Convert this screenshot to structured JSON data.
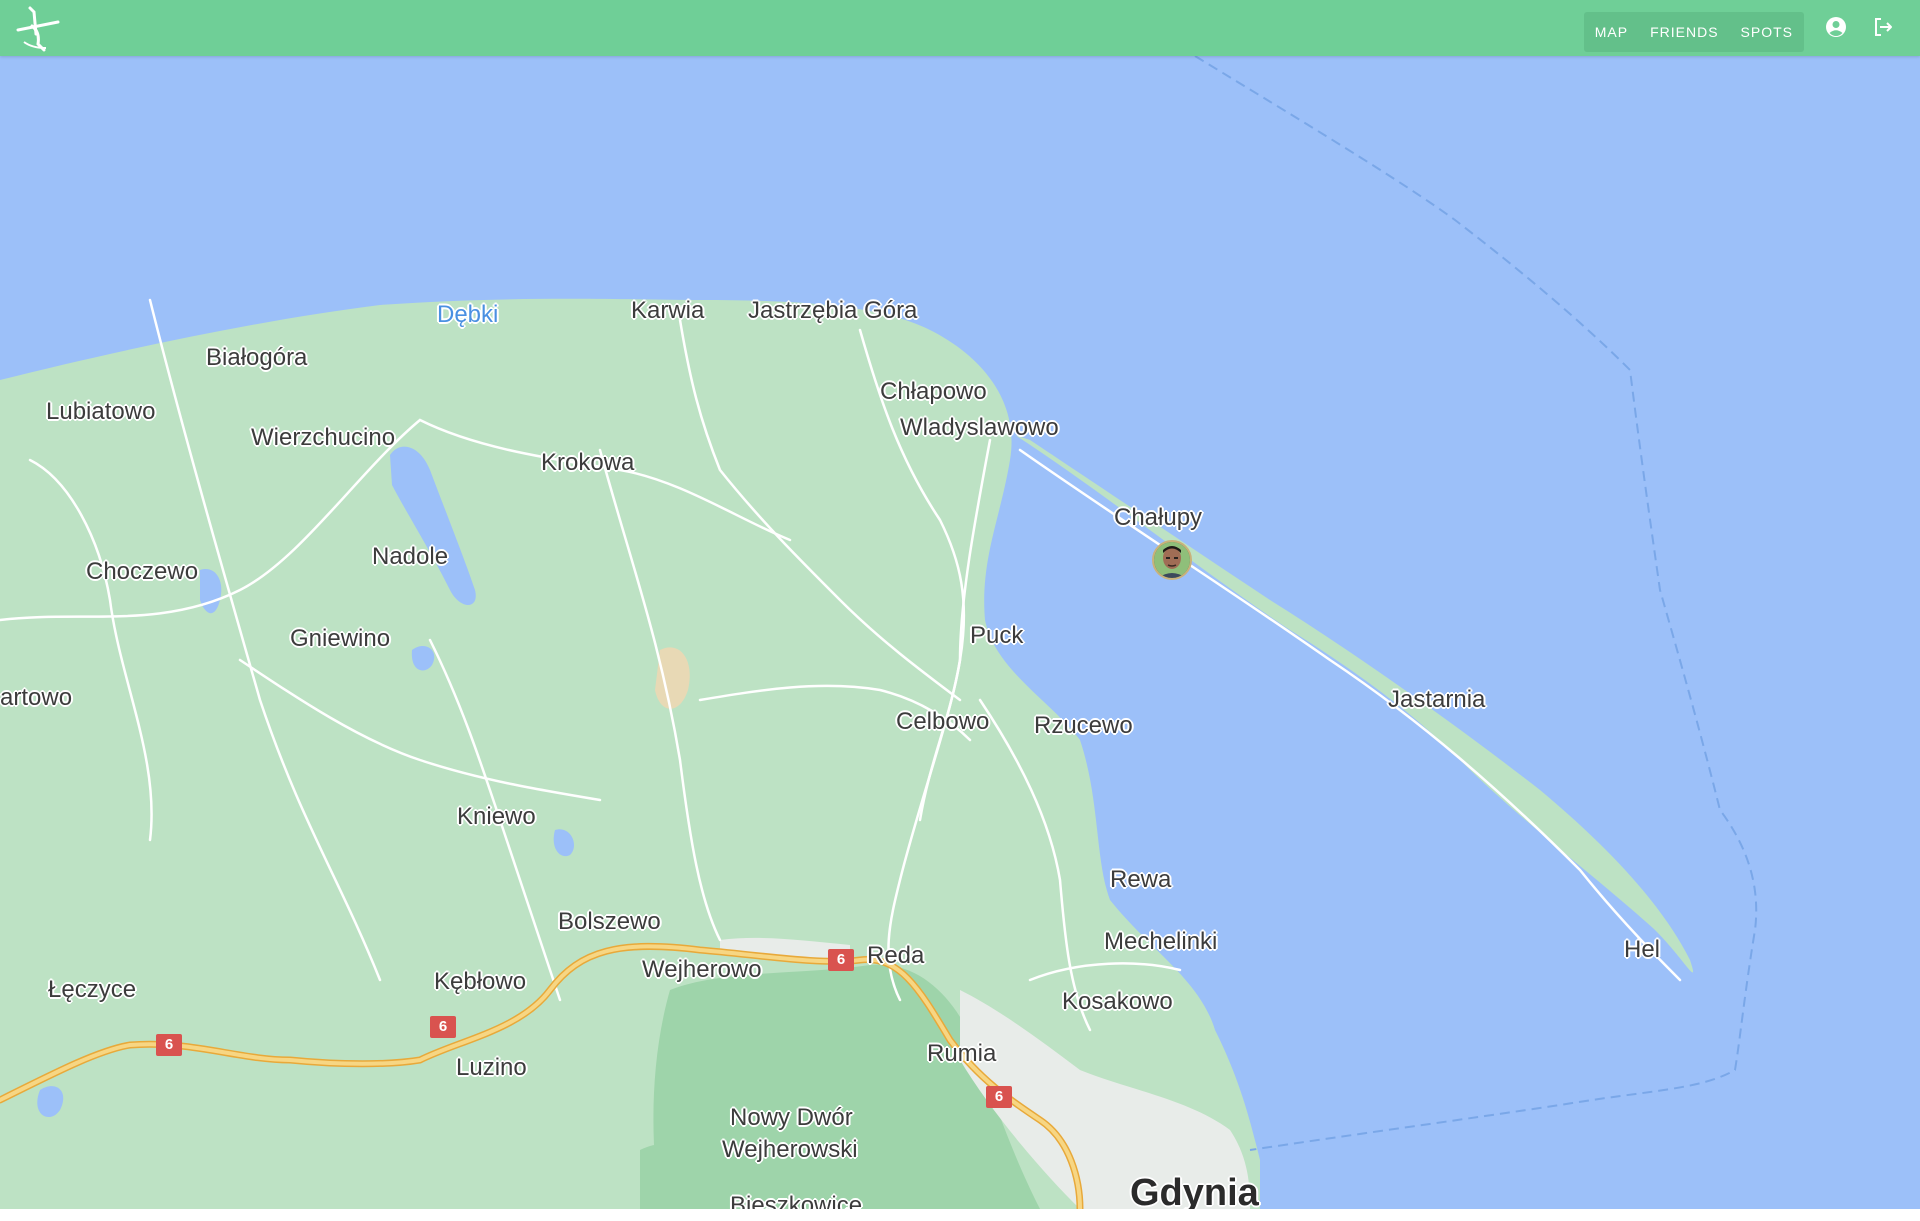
{
  "app": {
    "logo_icon": "windsurfer-logo-icon",
    "colors": {
      "header": "#6fcf97",
      "water": "#9cc0f9",
      "land": "#bde2c4",
      "forest": "#9ed4aa",
      "highway": "#f4c76a",
      "route_shield": "#d9534f"
    }
  },
  "nav": {
    "items": [
      {
        "label": "MAP"
      },
      {
        "label": "FRIENDS"
      },
      {
        "label": "SPOTS"
      }
    ],
    "account_icon": "account-circle-icon",
    "logout_icon": "logout-icon"
  },
  "map": {
    "water_labels": [
      "Dębki"
    ],
    "place_labels": [
      "Karwia",
      "Jastrzębia Góra",
      "Białogóra",
      "Lubiatowo",
      "Wierzchucino",
      "Krokowa",
      "Chłapowo",
      "Wladyslawowo",
      "Chałupy",
      "Choczewo",
      "Nadole",
      "Gniewino",
      "Puck",
      "artowo",
      "Celbowo",
      "Rzucewo",
      "Jastarnia",
      "Kniewo",
      "Rewa",
      "Bolszewo",
      "Reda",
      "Mechelinki",
      "Wejherowo",
      "Kębłowo",
      "Łęczyce",
      "Hel",
      "Kosakowo",
      "Rumia",
      "Luzino",
      "Nowy Dwór",
      "Wejherowski",
      "Bieszkowice"
    ],
    "city_labels": [
      "Gdynia"
    ],
    "route_shields": [
      "6",
      "6",
      "6",
      "6"
    ],
    "marker": {
      "type": "friend-avatar",
      "location": "Chałupy"
    }
  }
}
